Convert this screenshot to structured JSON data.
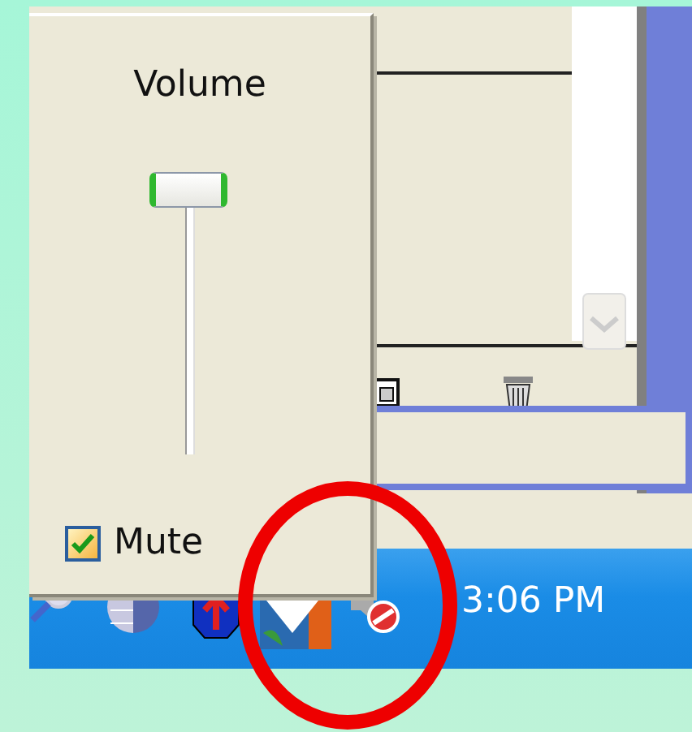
{
  "volume_popup": {
    "title": "Volume",
    "slider": {
      "level": 1
    },
    "mute": {
      "label": "Mute",
      "checked": true
    }
  },
  "taskbar": {
    "clock": "3:06 PM"
  },
  "annotation": {
    "kind": "ellipse",
    "color": "#ee0000"
  }
}
